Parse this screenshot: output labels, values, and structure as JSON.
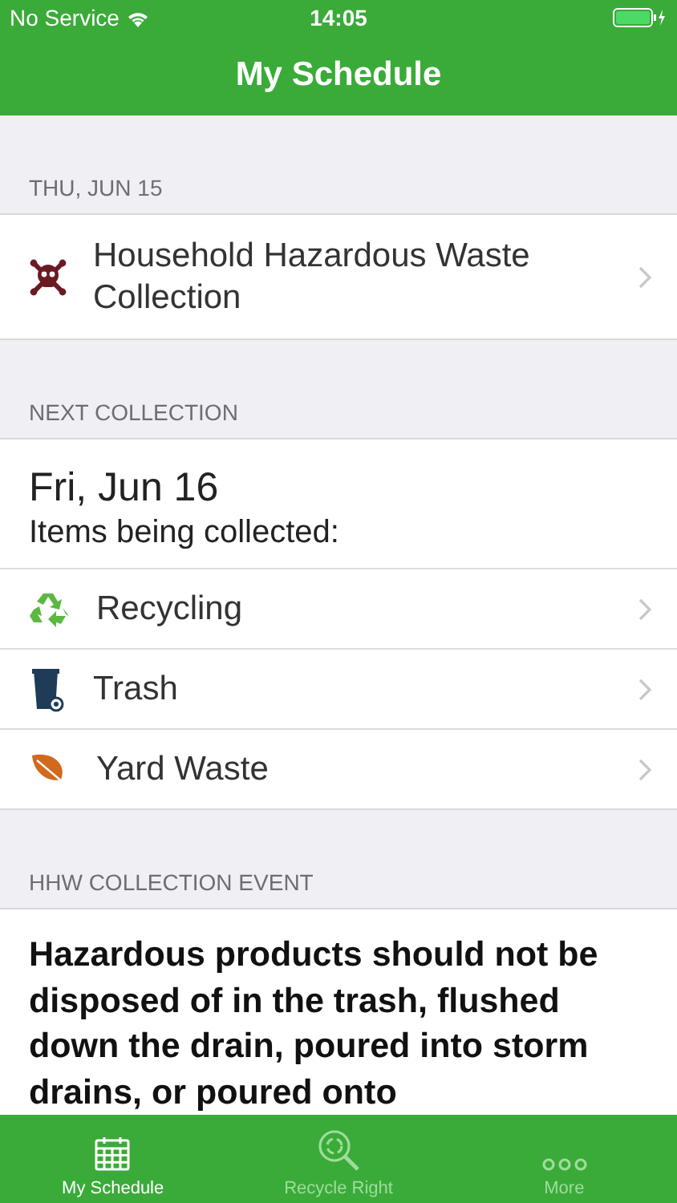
{
  "status_bar": {
    "carrier": "No Service",
    "time": "14:05"
  },
  "title": "My Schedule",
  "sections": [
    {
      "kind": "events",
      "header": "THU, JUN 15",
      "rows": [
        {
          "kind": "hazard",
          "label": "Household Hazardous Waste Collection"
        }
      ]
    },
    {
      "kind": "collection",
      "header": "NEXT COLLECTION",
      "date": "Fri, Jun 16",
      "subtitle": "Items being collected:",
      "rows": [
        {
          "kind": "recycle",
          "label": "Recycling"
        },
        {
          "kind": "trash",
          "label": "Trash"
        },
        {
          "kind": "yard",
          "label": "Yard Waste"
        }
      ]
    },
    {
      "kind": "notice",
      "header": "HHW COLLECTION EVENT",
      "text": "Hazardous products should not be disposed of in the trash, flushed down the drain, poured into storm drains, or poured onto"
    }
  ],
  "tabs": [
    {
      "kind": "schedule",
      "label": "My Schedule",
      "selected": true
    },
    {
      "kind": "recycle",
      "label": "Recycle Right",
      "selected": false
    },
    {
      "kind": "more",
      "label": "More",
      "selected": false
    }
  ]
}
